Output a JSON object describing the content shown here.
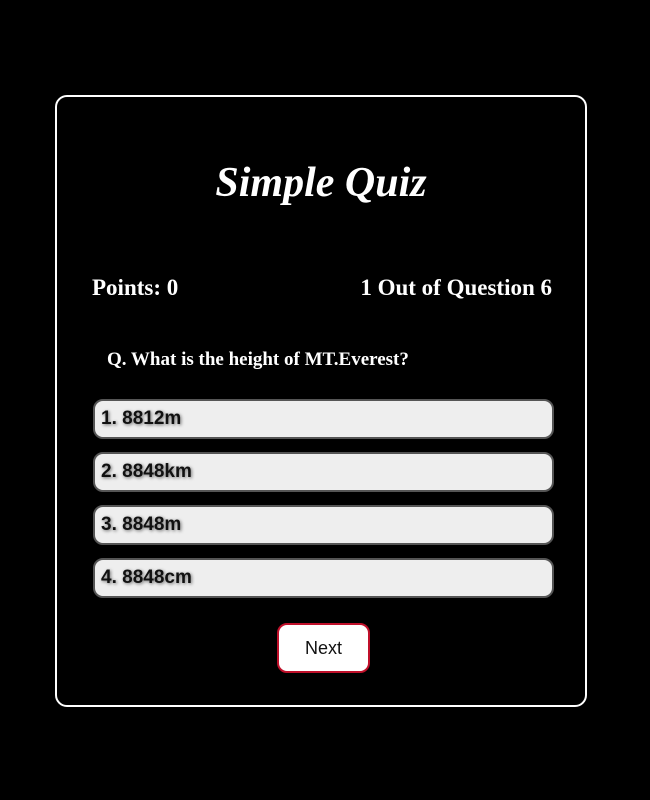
{
  "quiz": {
    "title": "Simple Quiz",
    "points_text": "Points: 0",
    "counter_text": "1 Out of Question 6",
    "question": "Q. What is the height of MT.Everest?",
    "options": [
      {
        "label": "1. 8812m"
      },
      {
        "label": "2. 8848km"
      },
      {
        "label": "3. 8848m"
      },
      {
        "label": "4. 8848cm"
      }
    ],
    "next_label": "Next"
  },
  "colors": {
    "background": "#000000",
    "card_border": "#ffffff",
    "option_bg": "#eeeeee",
    "next_border": "#c0102a"
  }
}
